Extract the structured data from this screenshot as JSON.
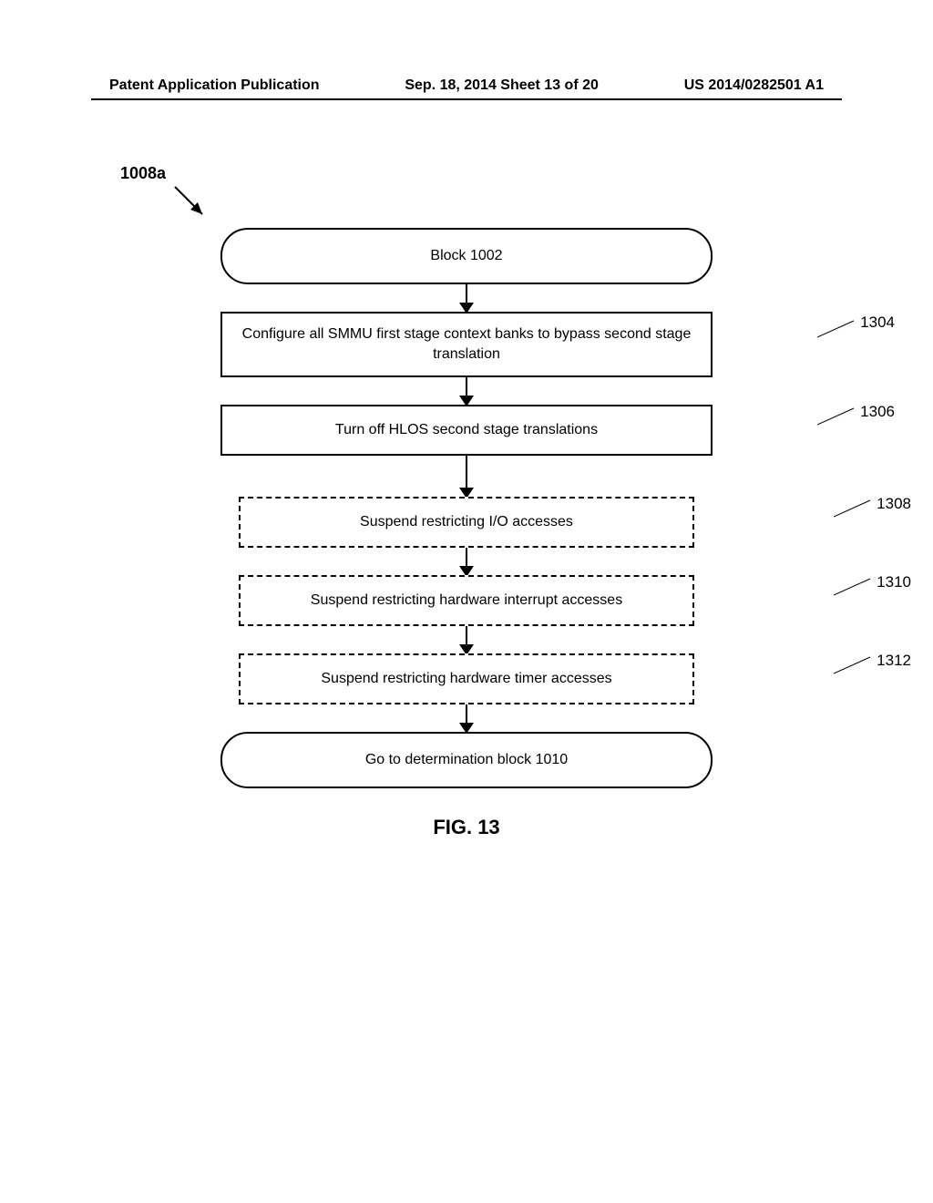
{
  "header": {
    "left": "Patent Application Publication",
    "center": "Sep. 18, 2014  Sheet 13 of 20",
    "right": "US 2014/0282501 A1"
  },
  "diagram": {
    "start_ref": "1008a",
    "boxes": [
      {
        "type": "rounded",
        "text": "Block 1002",
        "ref": ""
      },
      {
        "type": "solid",
        "text": "Configure all SMMU first stage context banks to bypass second stage translation",
        "ref": "1304"
      },
      {
        "type": "solid",
        "text": "Turn off HLOS second stage translations",
        "ref": "1306"
      },
      {
        "type": "dashed",
        "text": "Suspend restricting I/O accesses",
        "ref": "1308"
      },
      {
        "type": "dashed",
        "text": "Suspend restricting hardware interrupt accesses",
        "ref": "1310"
      },
      {
        "type": "dashed",
        "text": "Suspend restricting hardware timer accesses",
        "ref": "1312"
      },
      {
        "type": "rounded",
        "text": "Go to determination block 1010",
        "ref": ""
      }
    ],
    "figure_label": "FIG. 13"
  }
}
